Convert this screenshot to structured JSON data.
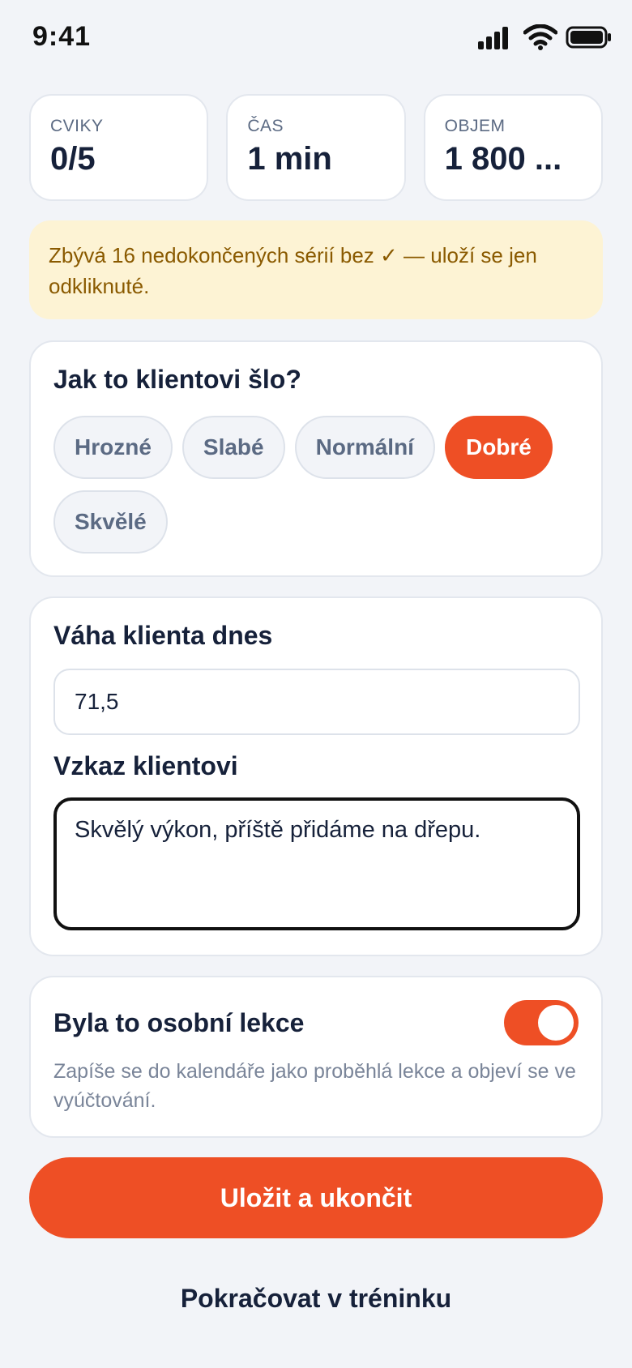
{
  "status_bar": {
    "time": "9:41",
    "icons": [
      "signal-icon",
      "wifi-icon",
      "battery-icon"
    ]
  },
  "stats": [
    {
      "label": "CVIKY",
      "value": "0/5"
    },
    {
      "label": "ČAS",
      "value": "1 min"
    },
    {
      "label": "OBJEM",
      "value": "1 800 ..."
    }
  ],
  "warning": {
    "text": "Zbývá 16 nedokončených sérií bez ✓ — uloží se jen odkliknuté."
  },
  "rating": {
    "title": "Jak to klientovi šlo?",
    "options": [
      "Hrozné",
      "Slabé",
      "Normální",
      "Dobré",
      "Skvělé"
    ],
    "selected": "Dobré"
  },
  "form": {
    "weight_label": "Váha klienta dnes",
    "weight_value": "71,5",
    "message_label": "Vzkaz klientovi",
    "message_value": "Skvělý výkon, příště přidáme na dřepu."
  },
  "lesson": {
    "title": "Byla to osobní lekce",
    "toggle_on": true,
    "description": "Zapíše se do kalendáře jako proběhlá lekce a objeví se ve vyúčtování."
  },
  "actions": {
    "save_label": "Uložit a ukončit",
    "continue_label": "Pokračovat v tréninku"
  },
  "colors": {
    "accent": "#ee4f25",
    "warning_bg": "#fdf3d4",
    "warning_text": "#8a5a00",
    "background": "#f2f4f8"
  }
}
